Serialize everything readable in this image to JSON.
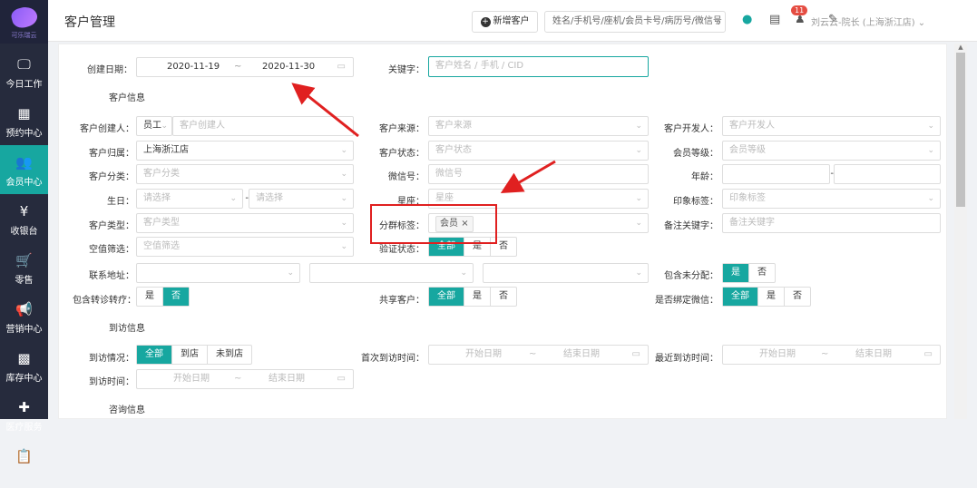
{
  "logo_text": "可乐瑞云",
  "nav": [
    {
      "label": "今日工作",
      "icon": "monitor-icon",
      "glyph": "🖵"
    },
    {
      "label": "预约中心",
      "icon": "calendar-icon",
      "glyph": "▦"
    },
    {
      "label": "会员中心",
      "icon": "users-icon",
      "glyph": "👥"
    },
    {
      "label": "收银台",
      "icon": "yen-icon",
      "glyph": "¥"
    },
    {
      "label": "零售",
      "icon": "cart-icon",
      "glyph": "🛒"
    },
    {
      "label": "营销中心",
      "icon": "megaphone-icon",
      "glyph": "📢"
    },
    {
      "label": "库存中心",
      "icon": "grid-icon",
      "glyph": "▩"
    },
    {
      "label": "医疗服务",
      "icon": "medkit-icon",
      "glyph": "✚"
    },
    {
      "label": "",
      "icon": "clipboard-icon",
      "glyph": "📋"
    }
  ],
  "header": {
    "title": "客户管理",
    "new_btn": "新增客户",
    "search_placeholder": "姓名/手机号/座机/会员卡号/病历号/微信号",
    "badge": "11",
    "user": "刘云云-院长 (上海浙江店)"
  },
  "filters": {
    "create_date_label": "创建日期：",
    "create_date_from": "2020-11-19",
    "create_date_sep": "~",
    "create_date_to": "2020-11-30",
    "keyword_label": "关键字：",
    "keyword_placeholder": "客户姓名 / 手机 / CID",
    "section_customer": "客户信息",
    "creator_label": "客户创建人：",
    "creator_type": "员工",
    "creator_placeholder": "客户创建人",
    "source_label": "客户来源：",
    "source_placeholder": "客户来源",
    "developer_label": "客户开发人：",
    "developer_placeholder": "客户开发人",
    "belong_label": "客户归属：",
    "belong_value": "上海浙江店",
    "status_label": "客户状态：",
    "status_placeholder": "客户状态",
    "member_level_label": "会员等级：",
    "member_level_placeholder": "会员等级",
    "category_label": "客户分类：",
    "category_placeholder": "客户分类",
    "wechat_label": "微信号：",
    "wechat_placeholder": "微信号",
    "age_label": "年龄：",
    "age_sep": "-",
    "birthday_label": "生日：",
    "birthday_placeholder": "请选择",
    "birthday_sep": "-",
    "constellation_label": "星座：",
    "constellation_placeholder": "星座",
    "impression_label": "印象标签：",
    "impression_placeholder": "印象标签",
    "type_label": "客户类型：",
    "type_placeholder": "客户类型",
    "group_tag_label": "分群标签：",
    "group_tag_value": "会员",
    "remark_label": "备注关键字：",
    "remark_placeholder": "备注关键字",
    "nullvalue_label": "空值筛选：",
    "nullvalue_placeholder": "空值筛选",
    "verify_label": "验证状态：",
    "address_label": "联系地址：",
    "unassigned_label": "包含未分配：",
    "referral_label": "包含转诊转疗：",
    "shared_label": "共享客户：",
    "bindwx_label": "是否绑定微信：",
    "section_visit": "到访信息",
    "visit_status_label": "到访情况：",
    "first_visit_label": "首次到访时间：",
    "last_visit_label": "最近到访时间：",
    "visit_time_label": "到访时间：",
    "start_date": "开始日期",
    "end_date": "结束日期",
    "section_consult": "咨询信息"
  },
  "opts": {
    "all": "全部",
    "yes": "是",
    "no": "否",
    "arrived": "到店",
    "not_arrived": "未到店"
  }
}
